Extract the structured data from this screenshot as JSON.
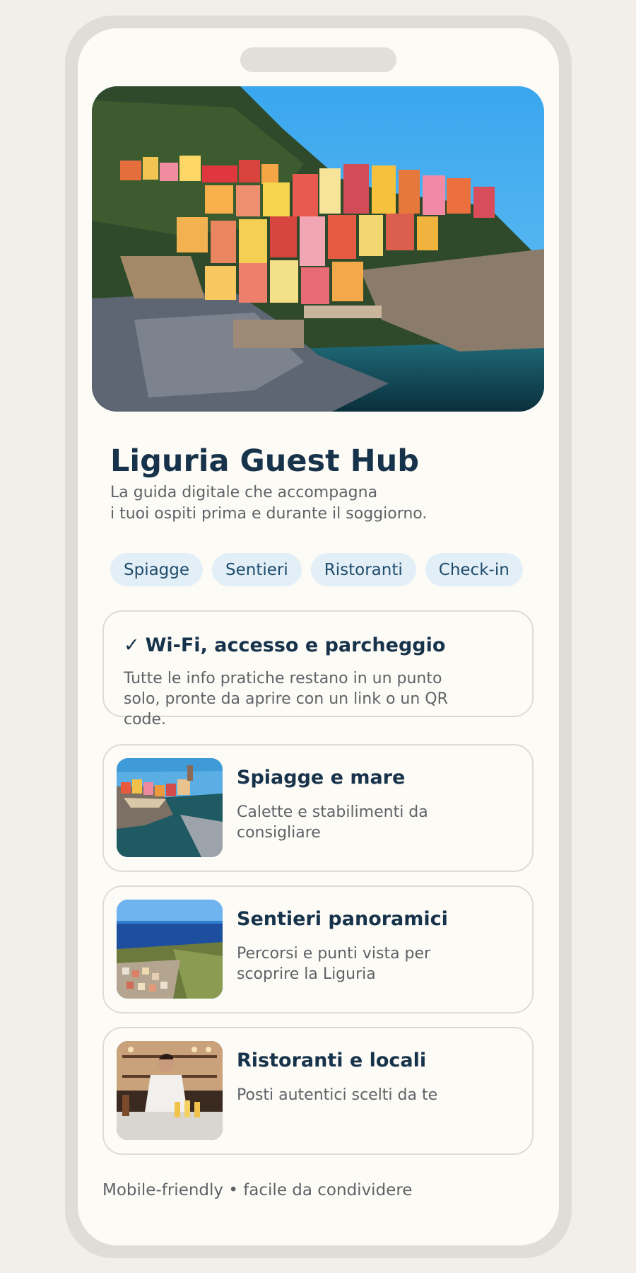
{
  "header": {
    "title": "Liguria Guest Hub",
    "subtitle_line1": "La guida digitale che accompagna",
    "subtitle_line2": "i tuoi ospiti prima e durante il soggiorno."
  },
  "chips": [
    "Spiagge",
    "Sentieri",
    "Ristoranti",
    "Check-in"
  ],
  "info_card": {
    "check": "✓",
    "title": "Wi-Fi, accesso e parcheggio",
    "description": "Tutte le info pratiche restano in un punto solo, pronte da aprire con un link o un QR code."
  },
  "features": [
    {
      "title": "Spiagge e mare",
      "description": "Calette e stabilimenti da consigliare",
      "icon": "beach-photo"
    },
    {
      "title": "Sentieri panoramici",
      "description": "Percorsi e punti vista per scoprire la Liguria",
      "icon": "trail-photo"
    },
    {
      "title": "Ristoranti e locali",
      "description": "Posti autentici scelti da te",
      "icon": "restaurant-photo"
    }
  ],
  "footer": "Mobile-friendly • facile da condividere",
  "colors": {
    "background": "#f2efe8",
    "screen": "#fdfbf6",
    "title": "#17334b",
    "text": "#5e6368",
    "chip_bg": "#e3eff7",
    "chip_text": "#1f4c6b"
  }
}
